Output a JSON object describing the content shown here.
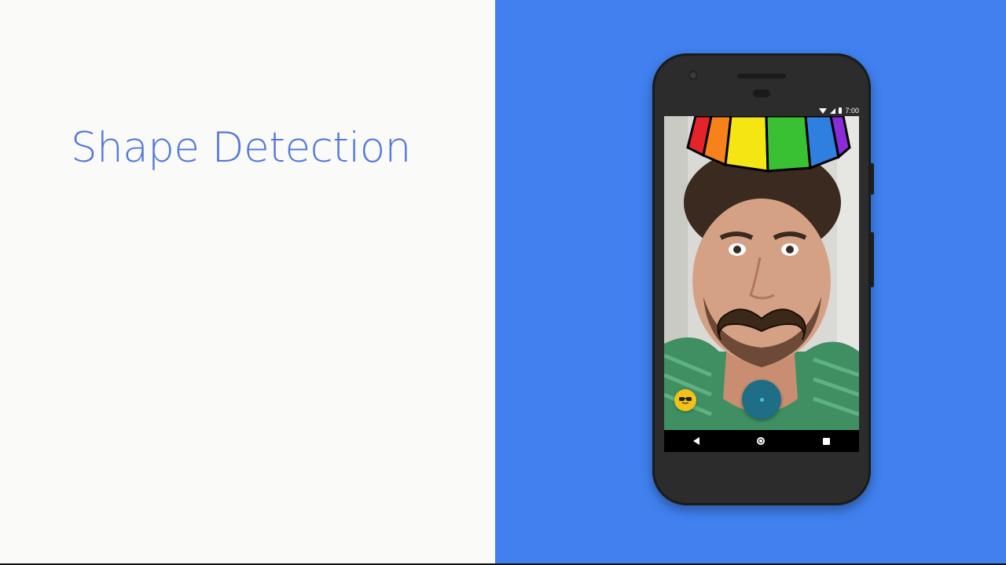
{
  "slide": {
    "title": "Shape Detection"
  },
  "phone": {
    "status_bar": {
      "time": "7:00",
      "icons": [
        "wifi-icon",
        "signal-icon",
        "battery-icon"
      ]
    },
    "camera_view": {
      "overlays": [
        "rainbow-hat",
        "mustache"
      ]
    },
    "controls": {
      "mask_button_icon": "sunglasses-emoji-icon",
      "shutter_button_icon": "record-dot-icon"
    },
    "nav_bar": {
      "buttons": [
        "back-icon",
        "home-icon",
        "recents-icon"
      ]
    }
  },
  "colors": {
    "left_background": "#fafaf8",
    "right_background": "#4081ef",
    "title": "#5077dc",
    "mask_button": "#f2c21b",
    "shutter_button": "#1e6f86"
  }
}
